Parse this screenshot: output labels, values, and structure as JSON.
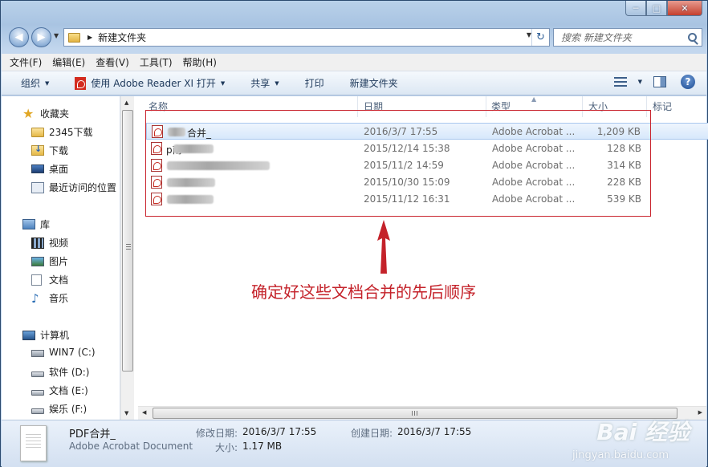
{
  "window": {
    "minimize_glyph": "─",
    "maximize_glyph": "□",
    "close_glyph": "✕"
  },
  "nav": {
    "back_glyph": "◀",
    "forward_glyph": "▶",
    "dropdown_glyph": "▼"
  },
  "address": {
    "separator": "▶",
    "path": "新建文件夹",
    "dropdown_glyph": "▼",
    "refresh_glyph": "↻"
  },
  "search": {
    "placeholder": "搜索 新建文件夹"
  },
  "menubar": {
    "items": [
      {
        "label": "文件(F)"
      },
      {
        "label": "编辑(E)"
      },
      {
        "label": "查看(V)"
      },
      {
        "label": "工具(T)"
      },
      {
        "label": "帮助(H)"
      }
    ]
  },
  "toolbar": {
    "organize": "组织",
    "open_with": "使用 Adobe Reader XI 打开",
    "share": "共享",
    "print": "打印",
    "new_folder": "新建文件夹",
    "caret": "▼",
    "help": "?"
  },
  "sidebar": {
    "favorites": {
      "title": "收藏夹",
      "items": [
        {
          "label": "2345下载",
          "icon": "folder-icon"
        },
        {
          "label": "下载",
          "icon": "downloads-icon"
        },
        {
          "label": "桌面",
          "icon": "desktop-icon"
        },
        {
          "label": "最近访问的位置",
          "icon": "recent-places-icon"
        }
      ]
    },
    "libraries": {
      "title": "库",
      "items": [
        {
          "label": "视频",
          "icon": "videos-icon"
        },
        {
          "label": "图片",
          "icon": "pictures-icon"
        },
        {
          "label": "文档",
          "icon": "documents-icon"
        },
        {
          "label": "音乐",
          "icon": "music-icon"
        }
      ]
    },
    "computer": {
      "title": "计算机",
      "items": [
        {
          "label": "WIN7 (C:)",
          "icon": "system-drive-icon"
        },
        {
          "label": "软件 (D:)",
          "icon": "drive-icon"
        },
        {
          "label": "文档 (E:)",
          "icon": "drive-icon"
        },
        {
          "label": "娱乐 (F:)",
          "icon": "drive-icon"
        }
      ]
    }
  },
  "columns": {
    "name": "名称",
    "date": "日期",
    "type": "类型",
    "size": "大小",
    "tags": "标记",
    "sort_glyph": "▲"
  },
  "files": [
    {
      "name": "合并_",
      "date": "2016/3/7 17:55",
      "type": "Adobe Acrobat ...",
      "size": "1,209 KB",
      "selected": true
    },
    {
      "name": "p南",
      "date": "2015/12/14 15:38",
      "type": "Adobe Acrobat ...",
      "size": "128 KB",
      "selected": false
    },
    {
      "name": "",
      "date": "2015/11/2 14:59",
      "type": "Adobe Acrobat ...",
      "size": "314 KB",
      "selected": false
    },
    {
      "name": "",
      "date": "2015/10/30 15:09",
      "type": "Adobe Acrobat ...",
      "size": "228 KB",
      "selected": false
    },
    {
      "name": "",
      "date": "2015/11/12 16:31",
      "type": "Adobe Acrobat ...",
      "size": "539 KB",
      "selected": false
    }
  ],
  "annotation": {
    "text": "确定好这些文档合并的先后顺序",
    "color": "#c4222a"
  },
  "scroll": {
    "up": "▲",
    "down": "▼",
    "left": "◀",
    "right": "▶"
  },
  "details": {
    "file_name": "PDF合并_",
    "file_type": "Adobe Acrobat Document",
    "modified_label": "修改日期:",
    "modified_value": "2016/3/7 17:55",
    "size_label": "大小:",
    "size_value": "1.17 MB",
    "created_label": "创建日期:",
    "created_value": "2016/3/7 17:55"
  },
  "watermark": {
    "brand": "Bai 经验",
    "url": "jingyan.baidu.com"
  }
}
